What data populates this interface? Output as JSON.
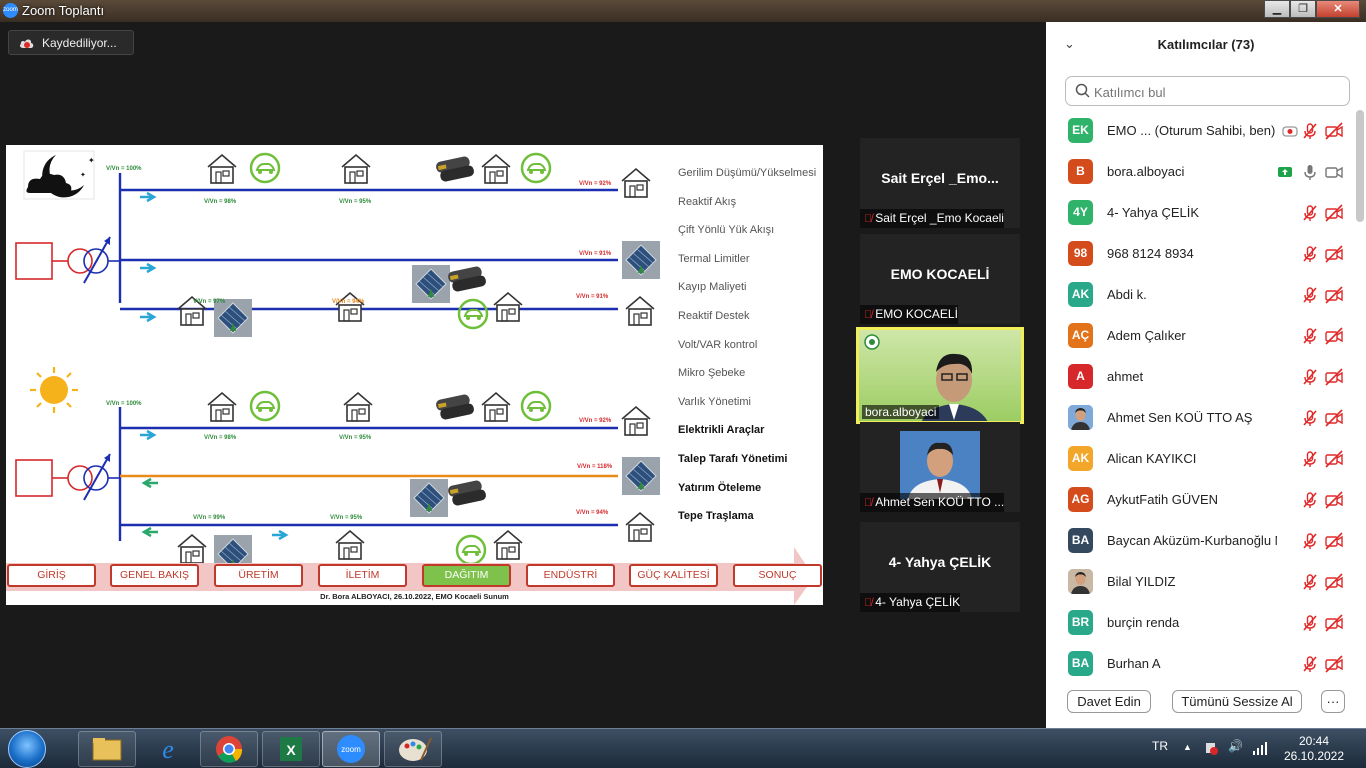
{
  "window": {
    "title": "Zoom Toplantı",
    "minimize": "▁",
    "maximize": "❐",
    "close": "✕"
  },
  "recording": {
    "label": "Kaydediliyor..."
  },
  "slide": {
    "voltages": {
      "n100": "V/Vn = 100%",
      "n98": "V/Vn = 98%",
      "n95": "V/Vn = 95%",
      "n92": "V/Vn = 92%",
      "n91a": "V/Vn = 91%",
      "n97": "V/Vn = 97%",
      "n94": "V/Vn = 94%",
      "n91b": "V/Vn = 91%",
      "d100": "V/Vn = 100%",
      "d98": "V/Vn = 98%",
      "d95": "V/Vn = 95%",
      "d92": "V/Vn = 92%",
      "d118": "V/Vn = 118%",
      "d99": "V/Vn = 99%",
      "d95b": "V/Vn = 95%",
      "d94": "V/Vn = 94%"
    },
    "legend": [
      "Gerilim Düşümü/Yükselmesi",
      "Reaktif Akış",
      "Çift Yönlü Yük Akışı",
      "Termal Limitler",
      "Kayıp Maliyeti",
      "Reaktif Destek",
      "Volt/VAR kontrol",
      "Mikro Şebeke",
      "Varlık Yönetimi",
      "Elektrikli Araçlar",
      "Talep Tarafı Yönetimi",
      "Yatırım Öteleme",
      "Tepe Traşlama"
    ],
    "nav": [
      "GİRİŞ",
      "GENEL BAKIŞ",
      "ÜRETİM",
      "İLETİM",
      "DAĞITIM",
      "ENDÜSTRİ",
      "GÜÇ KALİTESİ",
      "SONUÇ"
    ],
    "active_nav": "DAĞITIM",
    "footer": "Dr. Bora ALBOYACI, 26.10.2022, EMO Kocaeli Sunum"
  },
  "tiles": [
    {
      "display": "Sait Erçel _Emo...",
      "footer": "Sait Erçel _Emo Kocaeli"
    },
    {
      "display": "EMO KOCAELİ",
      "footer": "EMO KOCAELİ"
    },
    {
      "footer": "bora.alboyaci"
    },
    {
      "footer": "Ahmet Sen KOÜ TTO ..."
    },
    {
      "display": "4- Yahya ÇELİK",
      "footer": "4- Yahya ÇELİK"
    }
  ],
  "panel": {
    "title": "Katılımcılar (73)",
    "search_placeholder": "Katılımcı bul",
    "participants": [
      {
        "initials": "EK",
        "color": "#2fb36b",
        "name": "EMO ... (Oturum Sahibi, ben)"
      },
      {
        "initials": "B",
        "color": "#d44c1c",
        "name": "bora.alboyaci"
      },
      {
        "initials": "4Y",
        "color": "#2fb36b",
        "name": "4- Yahya ÇELİK"
      },
      {
        "initials": "98",
        "color": "#d44c1c",
        "name": "968 8124 8934"
      },
      {
        "initials": "AK",
        "color": "#2aa88a",
        "name": "Abdi k."
      },
      {
        "initials": "AÇ",
        "color": "#e2731b",
        "name": "Adem Çalıker"
      },
      {
        "initials": "A",
        "color": "#d6282b",
        "name": "ahmet"
      },
      {
        "initials": "",
        "color": "#7fa9d8",
        "name": "Ahmet Sen KOÜ TTO AŞ"
      },
      {
        "initials": "AK",
        "color": "#f2a62a",
        "name": "Alican KAYIKCI"
      },
      {
        "initials": "AG",
        "color": "#d44c1c",
        "name": "AykutFatih GÜVEN"
      },
      {
        "initials": "BA",
        "color": "#34495e",
        "name": "Baycan Aküzüm-Kurbanoğlu M..."
      },
      {
        "initials": "",
        "color": "#c9b8a4",
        "name": "Bilal YILDIZ"
      },
      {
        "initials": "BR",
        "color": "#2aa88a",
        "name": "burçin renda"
      },
      {
        "initials": "BA",
        "color": "#2aa88a",
        "name": "Burhan A"
      }
    ],
    "invite": "Davet Edin",
    "mute_all": "Tümünü Sessize Al",
    "more": "···"
  },
  "taskbar": {
    "lang": "TR",
    "time": "20:44",
    "date": "26.10.2022",
    "apps": [
      "explorer-icon",
      "ie-icon",
      "chrome-icon",
      "excel-icon",
      "zoom-icon",
      "paint-icon"
    ]
  }
}
